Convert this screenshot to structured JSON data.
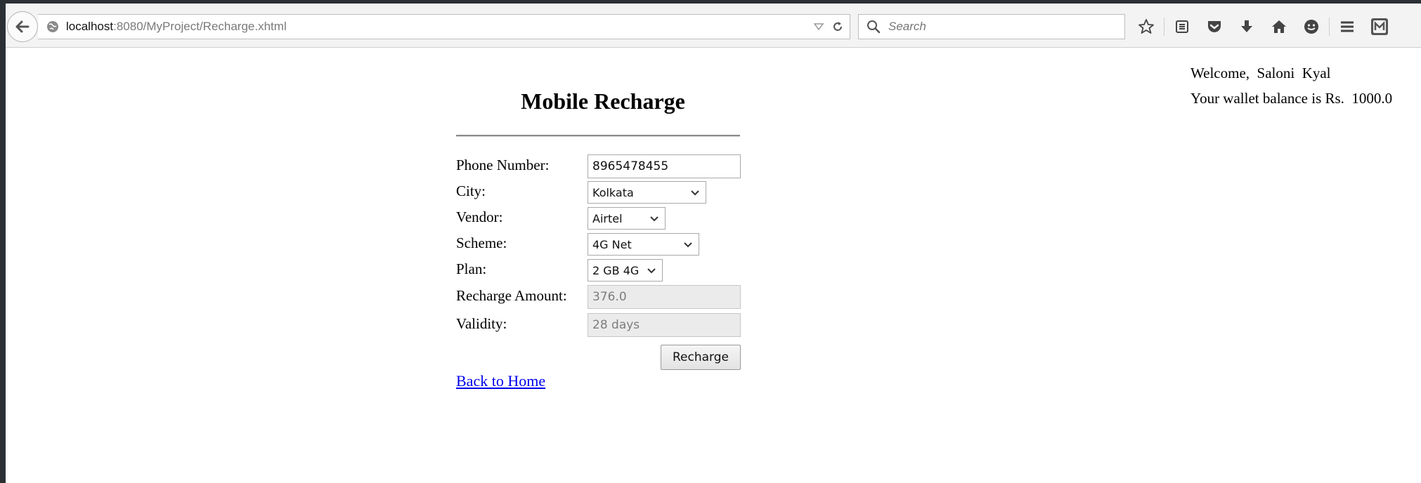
{
  "browser": {
    "url_host": "localhost",
    "url_rest": ":8080/MyProject/Recharge.xhtml",
    "search_placeholder": "Search"
  },
  "header": {
    "welcome_text": "Welcome,  Saloni  Kyal",
    "wallet_text": "Your wallet balance is Rs.  1000.0"
  },
  "form": {
    "title": "Mobile Recharge",
    "phone_label": "Phone Number:",
    "phone_value": "8965478455",
    "city_label": "City:",
    "city_value": "Kolkata",
    "vendor_label": "Vendor:",
    "vendor_value": "Airtel",
    "scheme_label": "Scheme:",
    "scheme_value": "4G Net",
    "plan_label": "Plan:",
    "plan_value": "2 GB 4G",
    "amount_label": "Recharge Amount:",
    "amount_value": "376.0",
    "validity_label": "Validity:",
    "validity_value": "28 days",
    "submit_label": "Recharge",
    "back_link": "Back to Home"
  },
  "icons": {
    "back": "back-arrow-icon",
    "site": "globe-icon",
    "url_dropdown": "triangle-down-icon",
    "reload": "reload-icon",
    "search": "magnifier-icon",
    "toolbar": [
      "star-icon",
      "reading-list-icon",
      "pocket-icon",
      "download-icon",
      "home-icon",
      "chat-icon",
      "menu-icon",
      "extension-icon"
    ]
  },
  "colors": {
    "link": "#0000ee",
    "chrome": "#f3f3f3",
    "frame": "#2b3035"
  }
}
